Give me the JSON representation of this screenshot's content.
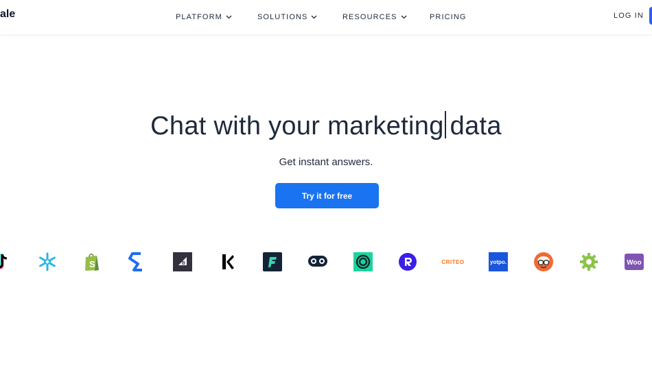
{
  "header": {
    "logo_text": "ale",
    "nav": {
      "platform": "PLATFORM",
      "solutions": "SOLUTIONS",
      "resources": "RESOURCES",
      "pricing": "PRICING"
    },
    "login": "LOG IN"
  },
  "hero": {
    "headline_before_cursor": "Chat with your marketing",
    "headline_after_cursor": "data",
    "subheadline": "Get instant answers.",
    "cta_label": "Try it for free"
  },
  "integrations": {
    "logos": [
      "tiktok-icon",
      "snowflake-icon",
      "shopify-icon",
      "stackadapt-icon",
      "bigcommerce-icon",
      "klaviyo-icon",
      "funnel-icon",
      "hootsuite-icon",
      "circular-icon",
      "rakuten-icon",
      "criteo-logo",
      "yotpo-logo",
      "lemlist-icon",
      "gear-icon",
      "woocommerce-icon"
    ],
    "criteo_text": "CRITEO",
    "yotpo_text": "yotpo.",
    "woo_text": "Woo"
  },
  "colors": {
    "accent": "#1a73f0",
    "text_dark": "#1e293b"
  }
}
